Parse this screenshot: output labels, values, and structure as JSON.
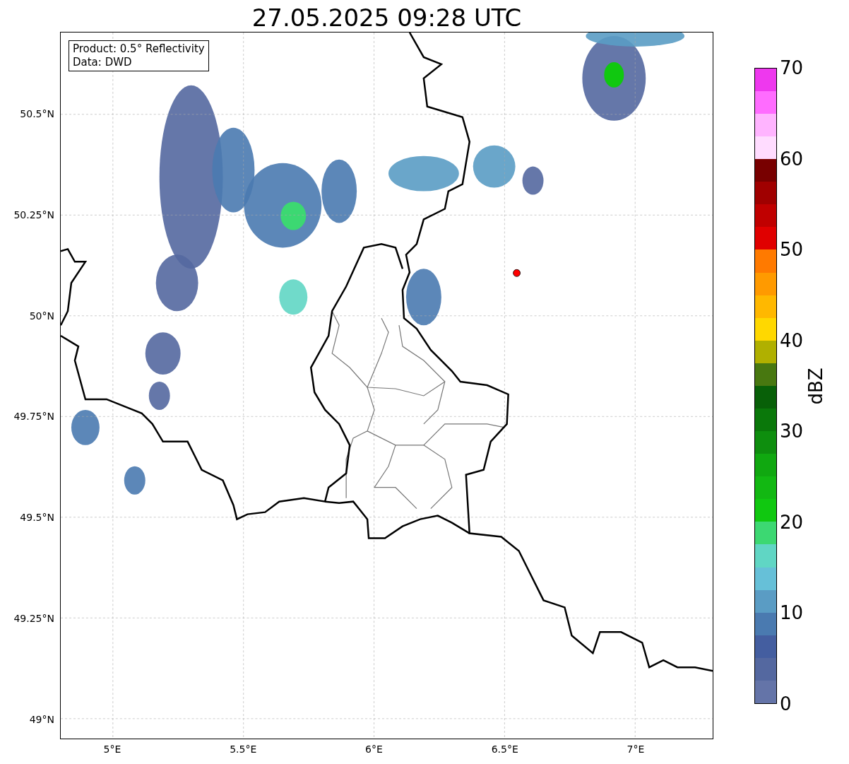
{
  "title": "27.05.2025 09:28 UTC",
  "legend": {
    "lines": [
      "Product: 0.5° Reflectivity",
      "Data: DWD"
    ]
  },
  "map": {
    "lat_labels": [
      "50.5°N",
      "50.25°N",
      "50°N",
      "49.75°N",
      "49.5°N",
      "49.25°N",
      "49°N"
    ],
    "lon_labels": [
      "5°E",
      "5.5°E",
      "6°E",
      "6.5°E",
      "7°E"
    ]
  },
  "colorbar": {
    "label": "dBZ",
    "ticks": [
      "70",
      "60",
      "50",
      "40",
      "30",
      "20",
      "10",
      "0"
    ],
    "segments": [
      {
        "color": "#6474a8"
      },
      {
        "color": "#5468a0"
      },
      {
        "color": "#445ea0"
      },
      {
        "color": "#4a7ab0"
      },
      {
        "color": "#5a9cc4"
      },
      {
        "color": "#66c0d8"
      },
      {
        "color": "#60d6c4"
      },
      {
        "color": "#3cd872"
      },
      {
        "color": "#10c810"
      },
      {
        "color": "#12b812"
      },
      {
        "color": "#10a810"
      },
      {
        "color": "#0e8e0e"
      },
      {
        "color": "#0a780a"
      },
      {
        "color": "#086008"
      },
      {
        "color": "#487810"
      },
      {
        "color": "#b0b000"
      },
      {
        "color": "#ffd800"
      },
      {
        "color": "#ffb800"
      },
      {
        "color": "#ff9a00"
      },
      {
        "color": "#ff7a00"
      },
      {
        "color": "#e00000"
      },
      {
        "color": "#c00000"
      },
      {
        "color": "#a00000"
      },
      {
        "color": "#780000"
      },
      {
        "color": "#ffdcff"
      },
      {
        "color": "#ffb4ff"
      },
      {
        "color": "#ff6cff"
      },
      {
        "color": "#ee38ee"
      }
    ]
  }
}
